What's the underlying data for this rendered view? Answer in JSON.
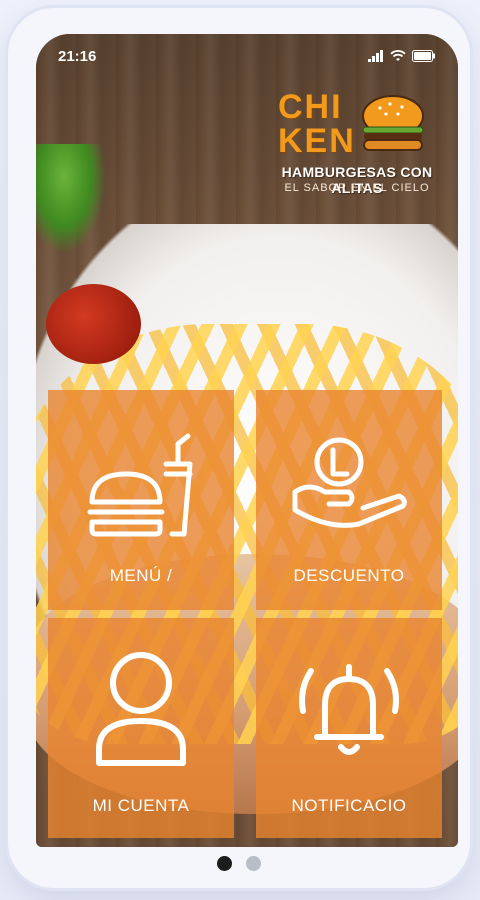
{
  "status_bar": {
    "time": "21:16"
  },
  "logo": {
    "line1": "CHI",
    "line2": "KEN",
    "tagline": "HAMBURGESAS CON ALITAS",
    "slogan": "EL SABOR EN EL CIELO"
  },
  "tiles": [
    {
      "label": "MENÚ /",
      "icon": "burger-drink-icon"
    },
    {
      "label": "DESCUENTO",
      "icon": "hand-coin-icon"
    },
    {
      "label": "MI CUENTA",
      "icon": "user-icon"
    },
    {
      "label": "NOTIFICACIO",
      "icon": "bell-ringing-icon"
    }
  ],
  "pager": {
    "pages": 2,
    "active": 1
  },
  "colors": {
    "tile": "#e88430",
    "logo": "#f29a1c",
    "active_dot": "#1c1c1c",
    "inactive_dot": "#b9bdc7"
  }
}
